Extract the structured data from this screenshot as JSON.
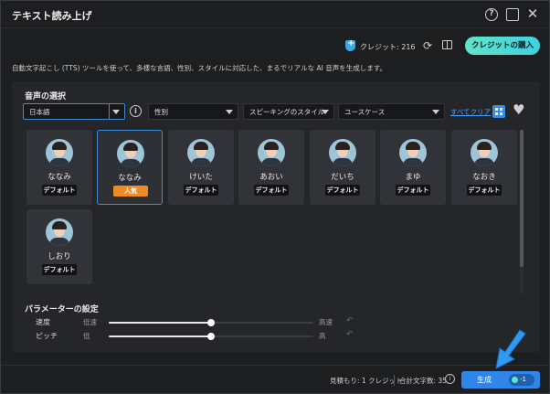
{
  "window": {
    "title": "テキスト読み上げ",
    "help_icon": "help-circle-icon",
    "maximize_icon": "maximize-icon",
    "close_icon": "close-icon"
  },
  "topbar": {
    "credit_text": "クレジット: 216",
    "buy_label": "クレジットの購入"
  },
  "description": "自動文字起こし (TTS) ツールを使って、多様な言語、性別、スタイルに対応した、まるでリアルな AI 音声を生成します。",
  "voice_section": {
    "label": "音声の選択",
    "filters": {
      "language": "日本語",
      "gender": "性別",
      "speaking_style": "スピーキングのスタイル",
      "use_case": "ユースケース",
      "clear_all": "すべてクリア"
    },
    "voices": [
      {
        "name": "ななみ",
        "tag": "デフォルト",
        "selected": false,
        "popular": false
      },
      {
        "name": "ななみ",
        "tag": "人気",
        "selected": true,
        "popular": true
      },
      {
        "name": "けいた",
        "tag": "デフォルト",
        "selected": false,
        "popular": false
      },
      {
        "name": "あおい",
        "tag": "デフォルト",
        "selected": false,
        "popular": false
      },
      {
        "name": "だいち",
        "tag": "デフォルト",
        "selected": false,
        "popular": false
      },
      {
        "name": "まゆ",
        "tag": "デフォルト",
        "selected": false,
        "popular": false
      },
      {
        "name": "なおき",
        "tag": "デフォルト",
        "selected": false,
        "popular": false
      },
      {
        "name": "しおり",
        "tag": "デフォルト",
        "selected": false,
        "popular": false
      }
    ]
  },
  "params": {
    "label": "パラメーターの設定",
    "speed": {
      "name": "速度",
      "min": "低速",
      "max": "高速",
      "value": 0.5
    },
    "pitch": {
      "name": "ピッチ",
      "min": "低",
      "max": "高",
      "value": 0.5
    }
  },
  "footer": {
    "estimate": "見積もり: 1 クレジット",
    "char_count": "合計文字数: 35",
    "generate_label": "生成",
    "generate_cost": "-1"
  }
}
